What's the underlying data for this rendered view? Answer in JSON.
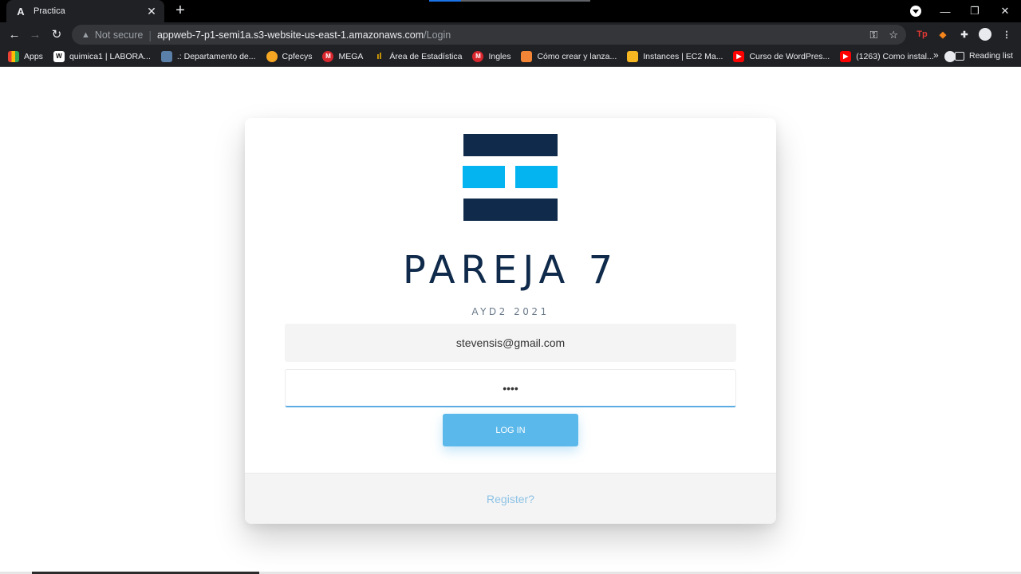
{
  "browser": {
    "tab_title": "Practica",
    "tab_favicon": "A",
    "security_label": "Not secure",
    "url_host": "appweb-7-p1-semi1a.s3-website-us-east-1.amazonaws.com",
    "url_path": "/Login",
    "bookmarks": [
      {
        "label": "Apps",
        "icon": "apps-grid-icon",
        "color": "#e8eaed"
      },
      {
        "label": "quimica1 | LABORA...",
        "icon": "wix-icon",
        "color": "#ffffff"
      },
      {
        "label": ".: Departamento de...",
        "icon": "department-icon",
        "color": "#5a7fa8"
      },
      {
        "label": "Cpfecys",
        "icon": "cpfecys-icon",
        "color": "#f5a623"
      },
      {
        "label": "MEGA",
        "icon": "mega-icon",
        "color": "#d9272e"
      },
      {
        "label": "Área de Estadística",
        "icon": "stats-icon",
        "color": "#f4b400"
      },
      {
        "label": "Ingles",
        "icon": "mega-icon",
        "color": "#d9272e"
      },
      {
        "label": "Cómo crear y lanza...",
        "icon": "aws-icon",
        "color": "#f58536"
      },
      {
        "label": "Instances | EC2 Ma...",
        "icon": "ec2-icon",
        "color": "#f5b622"
      },
      {
        "label": "Curso de WordPres...",
        "icon": "youtube-icon",
        "color": "#ff0000"
      },
      {
        "label": "(1263) Como instal...",
        "icon": "youtube-icon",
        "color": "#ff0000"
      }
    ],
    "bookmarks_more": "»",
    "reading_list": "Reading list"
  },
  "login": {
    "brand_title": "PAREJA 7",
    "brand_subtitle": "AYD2 2021",
    "email_value": "stevensis@gmail.com",
    "password_value": "••••",
    "login_button": "LOG IN",
    "register_link": "Register?"
  },
  "colors": {
    "navy": "#0f2a4a",
    "cyan": "#03b4f0",
    "button": "#5bb8ea",
    "link": "#8ec3e6"
  }
}
